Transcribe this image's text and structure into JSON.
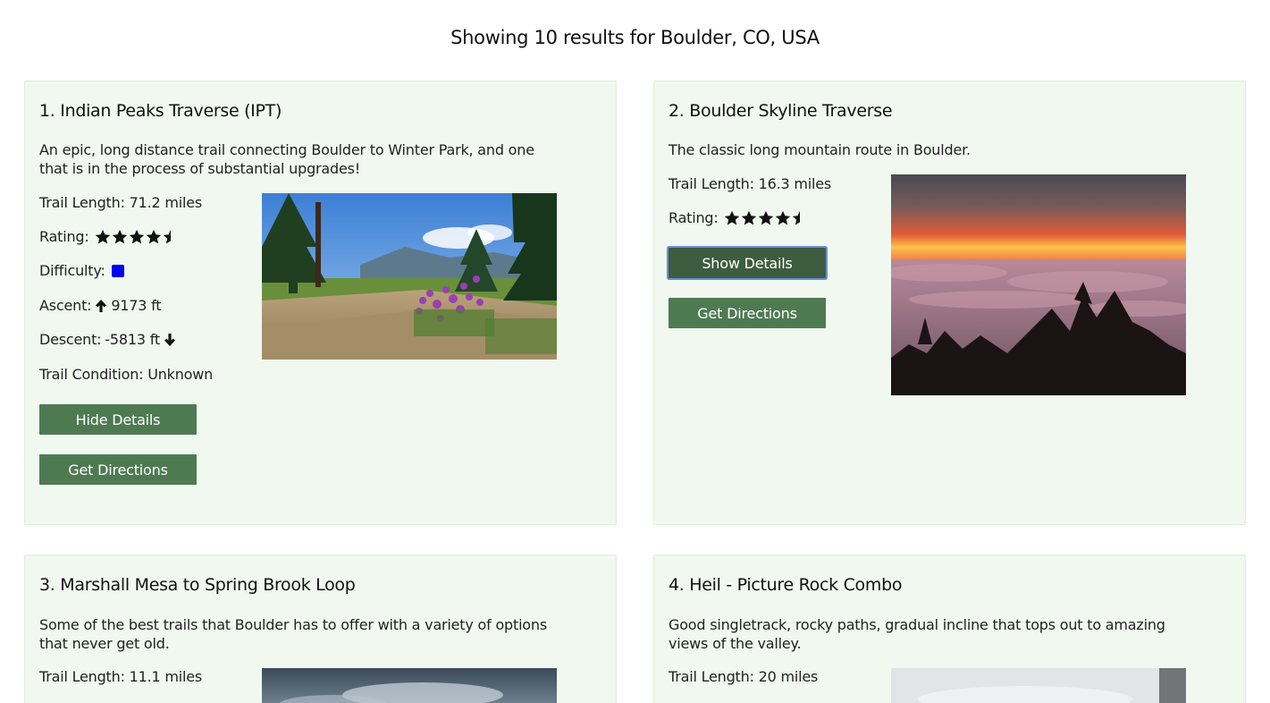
{
  "results": {
    "heading": "Showing 10 results for Boulder, CO, USA"
  },
  "trails": [
    {
      "title": "1. Indian Peaks Traverse (IPT)",
      "description": "An epic, long distance trail connecting Boulder to Winter Park, and one that is in the process of substantial upgrades!",
      "length": "Trail Length: 71.2 miles",
      "rating_label": "Rating:",
      "rating": 4.5,
      "difficulty_label": "Difficulty:",
      "difficulty_color": "#0000ee",
      "ascent_label": "Ascent:",
      "ascent_value": "9173 ft",
      "descent_label": "Descent:",
      "descent_value": "-5813 ft",
      "condition": "Trail Condition: Unknown",
      "details_button": "Hide Details",
      "directions_button": "Get Directions",
      "image_icon": "meadow-flowers-photo"
    },
    {
      "title": "2. Boulder Skyline Traverse",
      "description": "The classic long mountain route in Boulder.",
      "length": "Trail Length: 16.3 miles",
      "rating_label": "Rating:",
      "rating": 4.5,
      "details_button": "Show Details",
      "directions_button": "Get Directions",
      "image_icon": "sunset-clouds-photo"
    },
    {
      "title": "3. Marshall Mesa to Spring Brook Loop",
      "description": "Some of the best trails that Boulder has to offer with a variety of options that never get old.",
      "length": "Trail Length: 11.1 miles",
      "image_icon": "cloudy-sky-photo"
    },
    {
      "title": "4. Heil - Picture Rock Combo",
      "description": "Good singletrack, rocky paths, gradual incline that tops out to amazing views of the valley.",
      "length": "Trail Length: 20 miles",
      "image_icon": "overcast-sky-photo"
    }
  ],
  "colors": {
    "card_background": "#f0f8ef",
    "button": "#4e7a52",
    "button_focused": "#3e5c3f"
  }
}
